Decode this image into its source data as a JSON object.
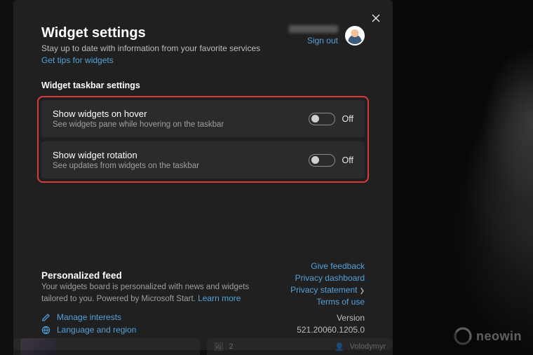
{
  "header": {
    "title": "Widget settings",
    "subtitle": "Stay up to date with information from your favorite services",
    "tips_link": "Get tips for widgets",
    "sign_out": "Sign out"
  },
  "taskbar_section": {
    "title": "Widget taskbar settings",
    "items": [
      {
        "title": "Show widgets on hover",
        "desc": "See widgets pane while hovering on the taskbar",
        "state": "Off"
      },
      {
        "title": "Show widget rotation",
        "desc": "See updates from widgets on the taskbar",
        "state": "Off"
      }
    ]
  },
  "feed": {
    "title": "Personalized feed",
    "desc": "Your widgets board is personalized with news and widgets tailored to you. Powered by Microsoft Start. ",
    "learn_more": "Learn more",
    "manage_interests": "Manage interests",
    "language_region": "Language and region"
  },
  "right_links": {
    "give_feedback": "Give feedback",
    "privacy_dashboard": "Privacy dashboard",
    "privacy_statement": "Privacy statement",
    "terms": "Terms of use",
    "version_label": "Version",
    "version": "521.20060.1205.0"
  },
  "watermark": "neowin",
  "peek": {
    "name": "Volodymyr",
    "badge": "2"
  }
}
